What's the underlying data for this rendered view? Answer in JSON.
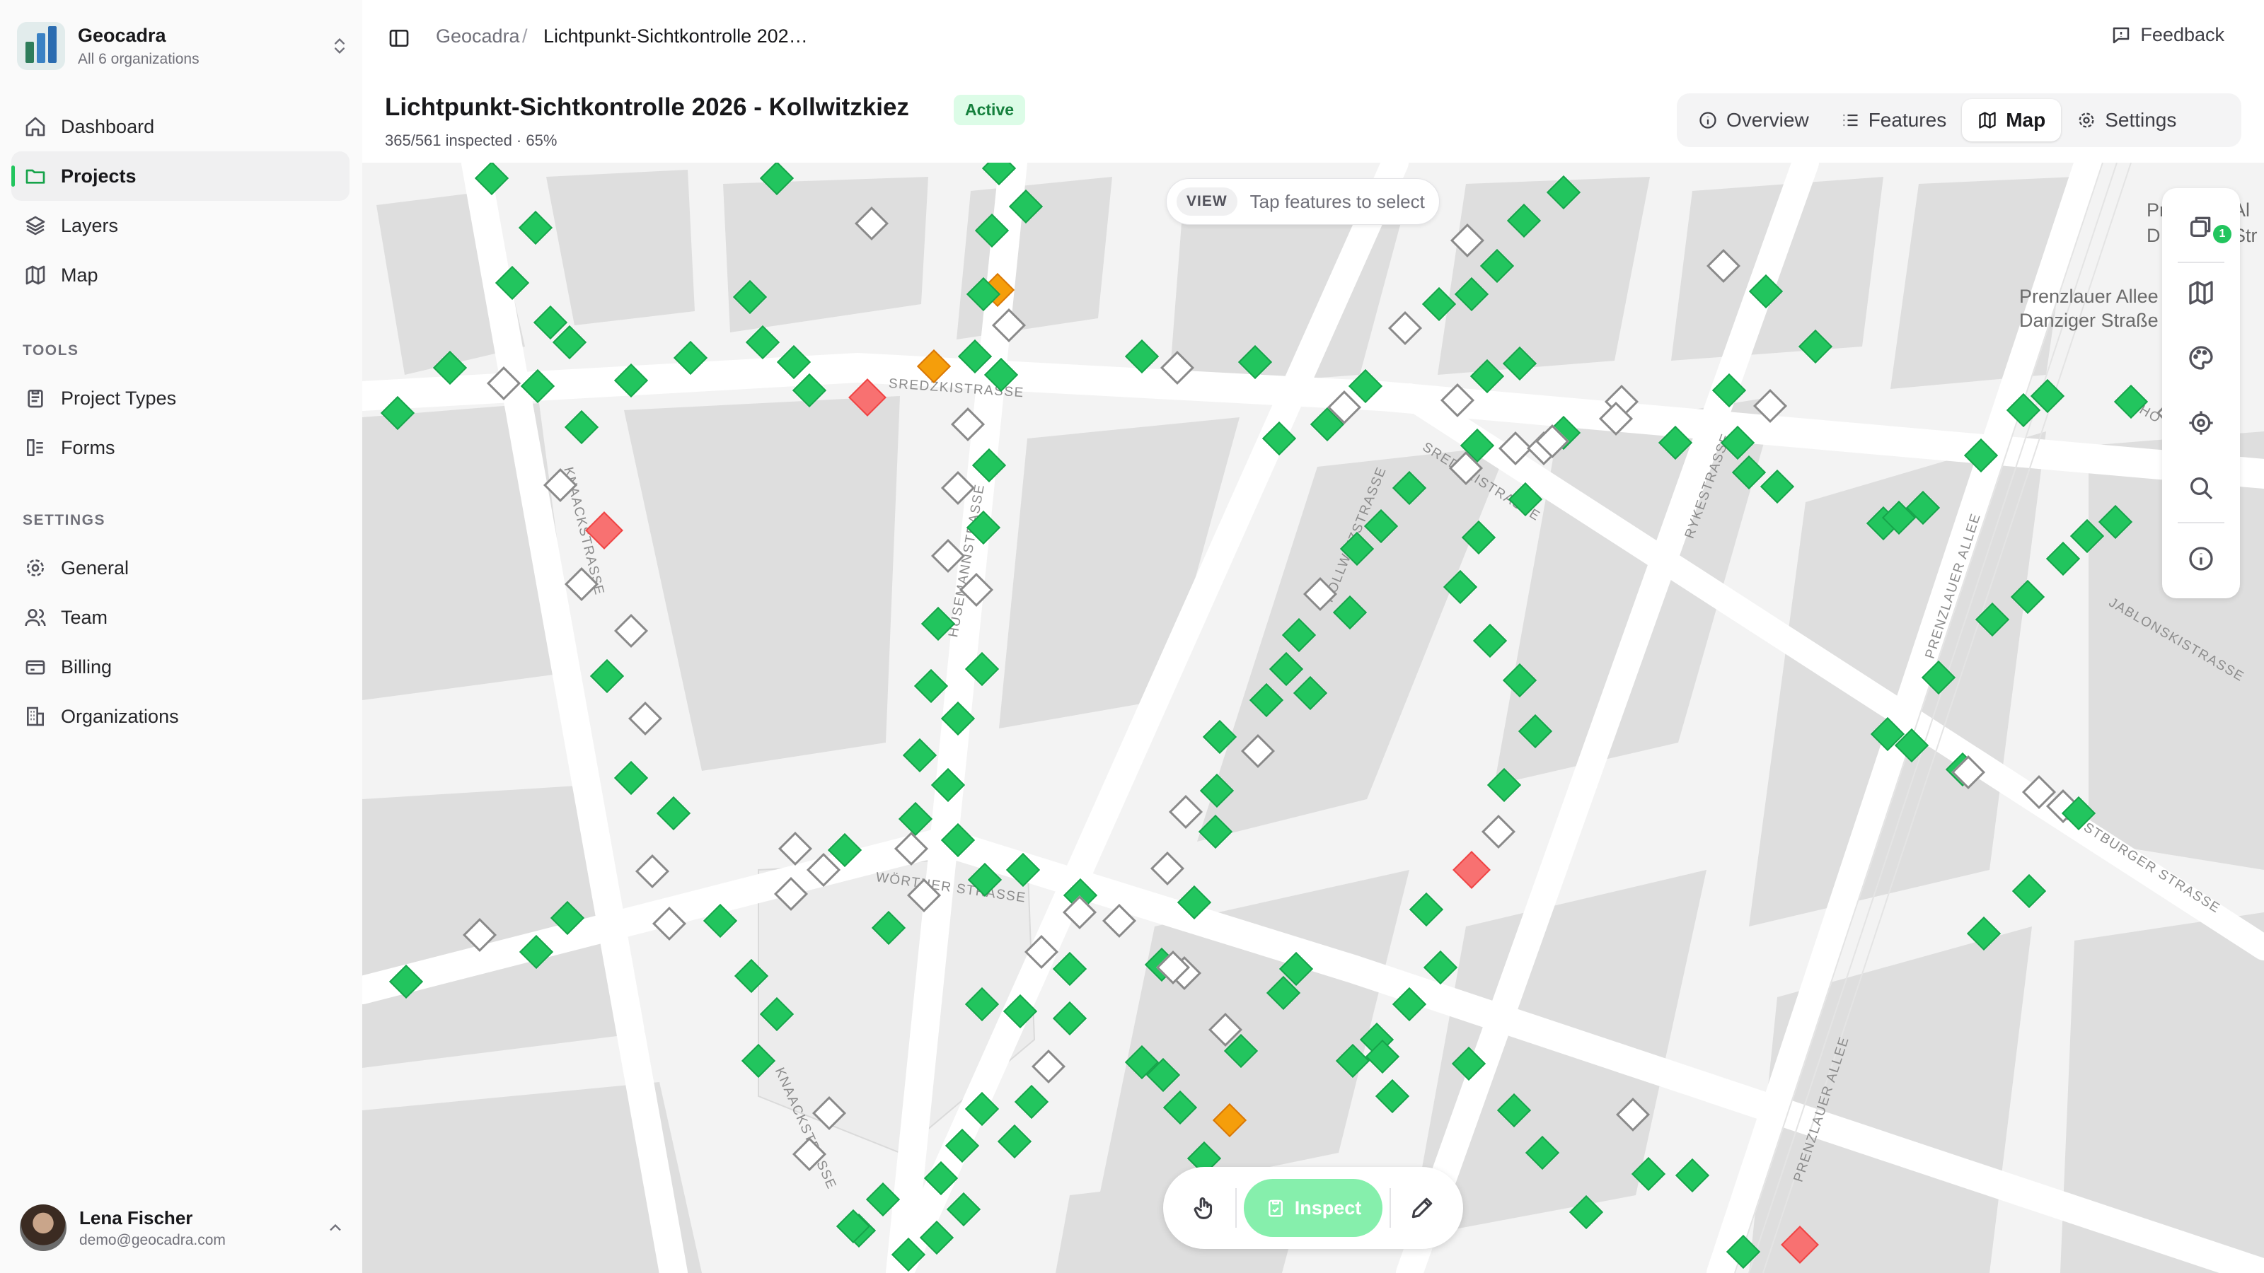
{
  "org": {
    "name": "Geocadra",
    "subtitle": "All 6 organizations"
  },
  "nav": {
    "main": [
      {
        "label": "Dashboard",
        "icon": "home-icon"
      },
      {
        "label": "Projects",
        "icon": "folder-icon",
        "active": true
      },
      {
        "label": "Layers",
        "icon": "layers-icon"
      },
      {
        "label": "Map",
        "icon": "map-icon"
      }
    ],
    "tools_title": "TOOLS",
    "tools": [
      {
        "label": "Project Types",
        "icon": "clipboard-icon"
      },
      {
        "label": "Forms",
        "icon": "form-icon"
      }
    ],
    "settings_title": "SETTINGS",
    "settings": [
      {
        "label": "General",
        "icon": "gear-icon"
      },
      {
        "label": "Team",
        "icon": "users-icon"
      },
      {
        "label": "Billing",
        "icon": "credit-card-icon"
      },
      {
        "label": "Organizations",
        "icon": "building-icon"
      }
    ]
  },
  "user": {
    "name": "Lena Fischer",
    "email": "demo@geocadra.com"
  },
  "breadcrumb": {
    "root": "Geocadra",
    "separator": "/",
    "current": "Lichtpunkt-Sichtkontrolle 202…"
  },
  "feedback_label": "Feedback",
  "project": {
    "title": "Lichtpunkt-Sichtkontrolle 2026 - Kollwitzkiez",
    "status": "Active",
    "progress_text": "365/561 inspected · 65%",
    "inspected": 365,
    "total": 561
  },
  "tabs": [
    {
      "label": "Overview",
      "icon": "info-icon"
    },
    {
      "label": "Features",
      "icon": "list-icon"
    },
    {
      "label": "Map",
      "icon": "map-icon",
      "active": true
    },
    {
      "label": "Settings",
      "icon": "gear-icon"
    }
  ],
  "map": {
    "mode_tag": "VIEW",
    "mode_hint": "Tap features to select",
    "layer_badge": "1",
    "streets": [
      "SREDZKISTRASSE",
      "KNAACKSTRASSE",
      "HUSEMANNSTRASSE",
      "KOLLWITZSTRASSE",
      "RYKESTRASSE",
      "WÖRTHER STRASSE",
      "PRENZLAUER ALLEE",
      "JABLONSKISTRASSE",
      "CHRISTBURGER STRASSE",
      "CHO"
    ],
    "places": [
      "Prenzlauer Allee",
      "Danziger Straße",
      "Pr",
      "Al",
      "D",
      "Str"
    ],
    "legend_colors": {
      "inspected": "#22c55e",
      "pending": "#ffffff",
      "warning": "#f59e0b",
      "defect": "#f87171"
    }
  },
  "toolbar": {
    "inspect_label": "Inspect"
  }
}
